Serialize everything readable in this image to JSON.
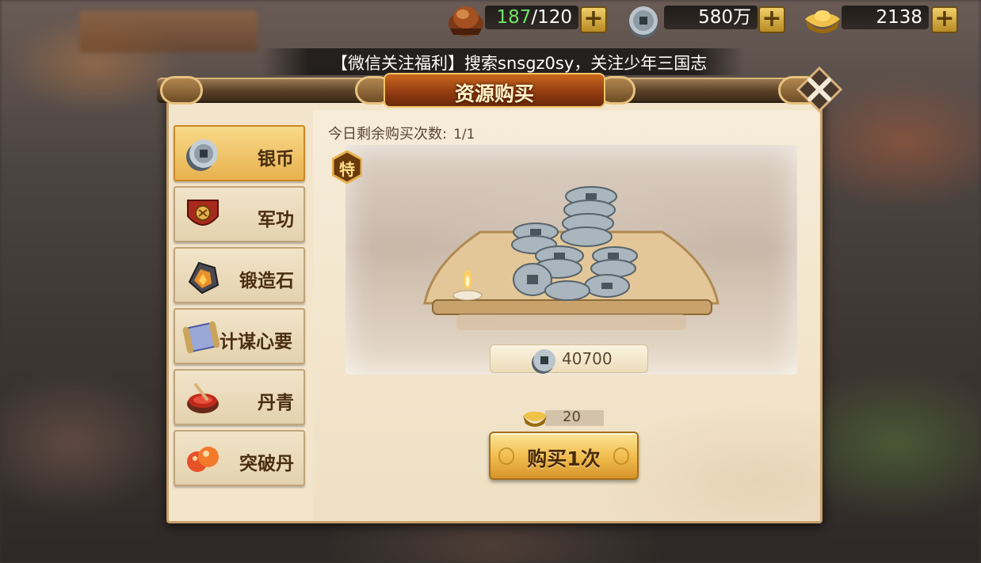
{
  "resources": [
    {
      "icon": "military-merit-icon",
      "current": "187",
      "max": "/120",
      "current_color": "#6fe26a"
    },
    {
      "icon": "silver-coin-icon",
      "value": "580万"
    },
    {
      "icon": "gold-ingot-icon",
      "value": "2138"
    }
  ],
  "marquee": {
    "text": "【微信关注福利】搜索snsgz0sy，关注少年三国志"
  },
  "dialog": {
    "title": "资源购买",
    "remaining_label": "今日剩余购买次数:",
    "remaining_value": "1/1",
    "special_badge": "特",
    "reward_amount": "40700",
    "cost": "20",
    "buy_label": "购买1次"
  },
  "sidebar": {
    "items": [
      {
        "label": "银币",
        "icon": "silver-coin-icon",
        "active": true
      },
      {
        "label": "军功",
        "icon": "merit-shield-icon",
        "active": false
      },
      {
        "label": "锻造石",
        "icon": "forge-stone-icon",
        "active": false
      },
      {
        "label": "计谋心要",
        "icon": "strategy-scroll-icon",
        "active": false
      },
      {
        "label": "丹青",
        "icon": "paint-bowl-icon",
        "active": false
      },
      {
        "label": "突破丹",
        "icon": "breakthrough-pill-icon",
        "active": false
      }
    ]
  },
  "colors": {
    "accent": "#e8b24e",
    "panel": "#f3e5cb",
    "title": "#8f3a10"
  }
}
